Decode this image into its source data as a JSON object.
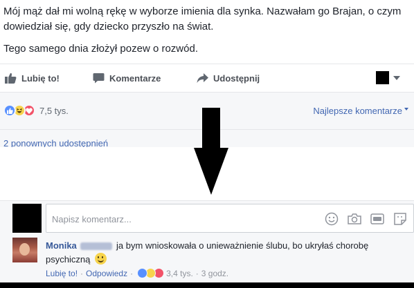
{
  "post": {
    "text_line1": "Mój mąż dał mi wolną rękę w wyborze imienia dla synka. Nazwałam go Brajan, o czym dowiedział się, gdy dziecko przyszło na świat.",
    "text_line2": "Tego samego dnia złożył pozew o rozwód."
  },
  "actions": {
    "like_label": "Lubię to!",
    "comment_label": "Komentarze",
    "share_label": "Udostępnij"
  },
  "stats": {
    "reactions_count": "7,5 tys.",
    "best_comments_label": "Najlepsze komentarze",
    "shares_label": "2 ponownych udostępnień"
  },
  "composer": {
    "placeholder": "Napisz komentarz..."
  },
  "comment": {
    "author": "Monika",
    "text": "ja bym wnioskowała o unieważnienie ślubu, bo ukryłaś chorobę psychiczną",
    "like_label": "Lubię to!",
    "reply_label": "Odpowiedz",
    "reactions_count": "3,4 tys.",
    "time": "3 godz."
  },
  "colors": {
    "link": "#4267b2",
    "like_reaction": "#5890ff",
    "haha_reaction": "#f7d44c",
    "love_reaction": "#f25268",
    "stats_bg": "#f6f7f9"
  },
  "icons": [
    "thumbs-up-icon",
    "comment-bubble-icon",
    "share-arrow-icon",
    "chevron-down-icon",
    "like-reaction-icon",
    "haha-reaction-icon",
    "love-reaction-icon",
    "down-arrow-icon",
    "emoji-icon",
    "camera-icon",
    "gif-icon",
    "sticker-icon",
    "smile-emoji-icon"
  ]
}
